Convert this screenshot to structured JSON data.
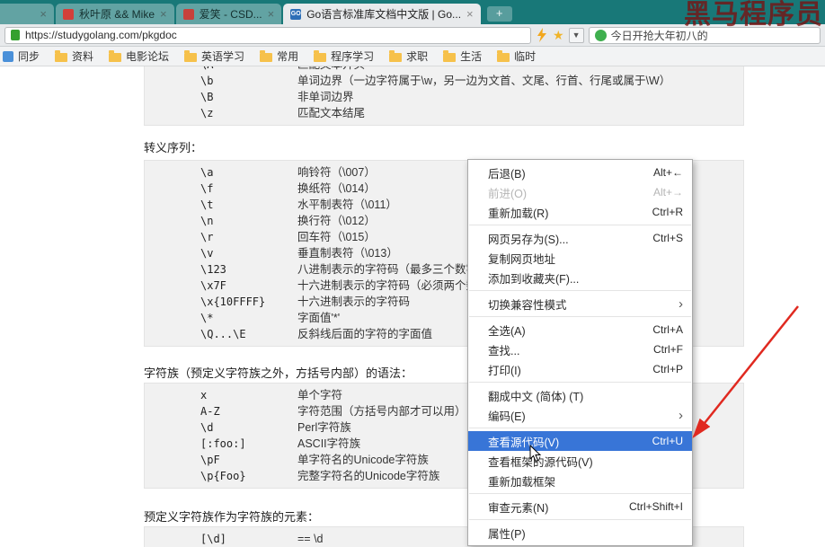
{
  "browser": {
    "tabs": [
      {
        "title": "",
        "stub": true
      },
      {
        "title": "秋叶原 && Mike",
        "favicon_color": "#d43f3a"
      },
      {
        "title": "爱笑 - CSD...",
        "favicon_color": "#c7413b"
      },
      {
        "title": "Go语言标准库文档中文版 | Go...",
        "favicon_color": "#2d6fb7",
        "favicon_text": "GO",
        "active": true
      }
    ],
    "new_tab_glyph": "+",
    "close_glyph": "×",
    "dropdown_glyph": "▼",
    "star_glyph": "★",
    "url": "https://studygolang.com/pkgdoc",
    "search_text": "今日开抢大年初八的",
    "watermark": "黑马程序员",
    "bookmarks": [
      {
        "label": "同步",
        "icon": "sync"
      },
      {
        "label": "资料",
        "icon": "folder"
      },
      {
        "label": "电影论坛",
        "icon": "folder"
      },
      {
        "label": "英语学习",
        "icon": "folder"
      },
      {
        "label": "常用",
        "icon": "folder"
      },
      {
        "label": "程序学习",
        "icon": "folder"
      },
      {
        "label": "求职",
        "icon": "folder"
      },
      {
        "label": "生活",
        "icon": "folder"
      },
      {
        "label": "临时",
        "icon": "folder"
      }
    ]
  },
  "content": {
    "intro_rows": [
      {
        "code": "\\A",
        "desc": "匹配文本开头"
      },
      {
        "code": "\\b",
        "desc": "单词边界（一边字符属于\\w，另一边为文首、文尾、行首、行尾或属于\\W）"
      },
      {
        "code": "\\B",
        "desc": "非单词边界"
      },
      {
        "code": "\\z",
        "desc": "匹配文本结尾"
      }
    ],
    "section_escape": "转义序列：",
    "escape_rows": [
      {
        "code": "\\a",
        "desc": "响铃符（\\007）"
      },
      {
        "code": "\\f",
        "desc": "换纸符（\\014）"
      },
      {
        "code": "\\t",
        "desc": "水平制表符（\\011）"
      },
      {
        "code": "\\n",
        "desc": "换行符（\\012）"
      },
      {
        "code": "\\r",
        "desc": "回车符（\\015）"
      },
      {
        "code": "\\v",
        "desc": "垂直制表符（\\013）"
      },
      {
        "code": "\\123",
        "desc": "八进制表示的字符码（最多三个数字）"
      },
      {
        "code": "\\x7F",
        "desc": "十六进制表示的字符码（必须两个数字）"
      },
      {
        "code": "\\x{10FFFF}",
        "desc": "十六进制表示的字符码"
      },
      {
        "code": "\\*",
        "desc": "字面值'*'"
      },
      {
        "code": "\\Q...\\E",
        "desc": "反斜线后面的字符的字面值"
      }
    ],
    "section_charclass": "字符族（预定义字符族之外，方括号内部）的语法：",
    "charclass_rows": [
      {
        "code": "x",
        "desc": "单个字符"
      },
      {
        "code": "A-Z",
        "desc": "字符范围（方括号内部才可以用）"
      },
      {
        "code": "\\d",
        "desc": "Perl字符族"
      },
      {
        "code": "[:foo:]",
        "desc": "ASCII字符族"
      },
      {
        "code": "\\pF",
        "desc": "单字符名的Unicode字符族"
      },
      {
        "code": "\\p{Foo}",
        "desc": "完整字符名的Unicode字符族"
      }
    ],
    "section_predef": "预定义字符族作为字符族的元素：",
    "predef_rows": [
      {
        "code": "[\\d]",
        "desc": "== \\d"
      }
    ]
  },
  "context_menu": {
    "items": [
      {
        "label": "后退(B)",
        "shortcut": "Alt+←"
      },
      {
        "label": "前进(O)",
        "shortcut": "Alt+→",
        "disabled": true
      },
      {
        "label": "重新加载(R)",
        "shortcut": "Ctrl+R"
      },
      {
        "separator": true
      },
      {
        "label": "网页另存为(S)...",
        "shortcut": "Ctrl+S"
      },
      {
        "label": "复制网页地址",
        "shortcut": ""
      },
      {
        "label": "添加到收藏夹(F)...",
        "shortcut": ""
      },
      {
        "separator": true
      },
      {
        "label": "切换兼容性模式",
        "shortcut": "",
        "submenu": true
      },
      {
        "separator": true
      },
      {
        "label": "全选(A)",
        "shortcut": "Ctrl+A"
      },
      {
        "label": "查找...",
        "shortcut": "Ctrl+F"
      },
      {
        "label": "打印(I)",
        "shortcut": "Ctrl+P"
      },
      {
        "separator": true
      },
      {
        "label": "翻成中文 (简体) (T)",
        "shortcut": ""
      },
      {
        "label": "编码(E)",
        "shortcut": "",
        "submenu": true
      },
      {
        "separator": true
      },
      {
        "label": "查看源代码(V)",
        "shortcut": "Ctrl+U",
        "highlighted": true
      },
      {
        "label": "查看框架的源代码(V)",
        "shortcut": ""
      },
      {
        "label": "重新加载框架",
        "shortcut": ""
      },
      {
        "separator": true
      },
      {
        "label": "审查元素(N)",
        "shortcut": "Ctrl+Shift+I"
      },
      {
        "separator": true
      },
      {
        "label": "属性(P)",
        "shortcut": ""
      }
    ]
  },
  "colors": {
    "chrome_teal": "#187878",
    "menu_highlight": "#3875d7",
    "annotation_red": "#e02920",
    "bookmark_folder": "#f6c14b"
  }
}
